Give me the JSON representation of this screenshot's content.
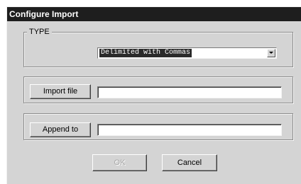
{
  "window": {
    "title": "Configure Import"
  },
  "type_group": {
    "legend": "TYPE",
    "select_value": "Delimited with Commas"
  },
  "import_group": {
    "button_label": "Import file",
    "value": ""
  },
  "append_group": {
    "button_label": "Append to",
    "value": ""
  },
  "buttons": {
    "ok_label": "OK",
    "cancel_label": "Cancel"
  },
  "colors": {
    "face": "#d4d4d4",
    "titlebar": "#1e1e1e",
    "selection": "#2a2a2a"
  },
  "icons": {
    "combo_arrow": "chevron-down-icon"
  }
}
